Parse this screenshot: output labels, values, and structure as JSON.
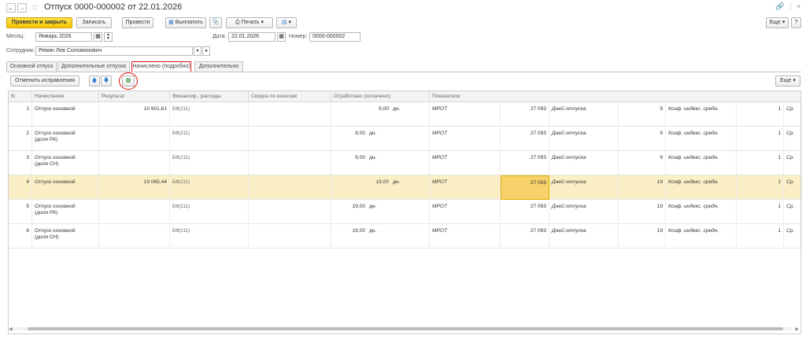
{
  "window": {
    "title": "Отпуск 0000-000002 от 22.01.2026",
    "more_label": "Еще",
    "help_label": "?"
  },
  "toolbar": {
    "post_close": "Провести и закрыть",
    "save": "Записать",
    "post": "Провести",
    "pay": "Выплатить",
    "print": "Печать"
  },
  "form": {
    "month_label": "Месяц:",
    "month_value": "Январь 2026",
    "date_label": "Дата:",
    "date_value": "22.01.2026",
    "number_label": "Номер:",
    "number_value": "0000-000002",
    "employee_label": "Сотрудник:",
    "employee_value": "Ревин Лев Соломонович"
  },
  "tabs": [
    {
      "label": "Основной отпуск"
    },
    {
      "label": "Дополнительные отпуска"
    },
    {
      "label": "Начислено (подробно)"
    },
    {
      "label": "Дополнительно"
    }
  ],
  "table_toolbar": {
    "cancel_corrections": "Отменить исправления",
    "more_label": "Еще"
  },
  "columns": {
    "n": "N",
    "accrual": "Начисления",
    "result": "Результат",
    "fin": "Финансир., расходы",
    "discount": "Скидка по взносам",
    "worked": "Отработано (оплачено)",
    "indicators": "Показатели"
  },
  "rows": [
    {
      "n": "1",
      "name1": "Отпуск основной",
      "name2": "",
      "result": "10 601,61",
      "fin": "БФ(211)",
      "worked": "9,00",
      "unit": "дн.",
      "mrot": "МРОТ",
      "mrot_val": "27 093",
      "ind1": "Дней отпуска",
      "ind1_val": "9",
      "ind2": "Коэф. индекс. средн.",
      "ind2_val": "1",
      "ind3": "Ср."
    },
    {
      "n": "2",
      "name1": "Отпуск основной",
      "name2": "(доля РК)",
      "result": "",
      "fin": "БФ(211)",
      "worked": "9,00",
      "unit": "дн.",
      "mrot": "МРОТ",
      "mrot_val": "27 093",
      "ind1": "Дней отпуска",
      "ind1_val": "9",
      "ind2": "Коэф. индекс. средн.",
      "ind2_val": "1",
      "ind3": "Ср."
    },
    {
      "n": "3",
      "name1": "Отпуск основной",
      "name2": "(доля СН)",
      "result": "",
      "fin": "БФ(211)",
      "worked": "9,00",
      "unit": "дн.",
      "mrot": "МРОТ",
      "mrot_val": "27 093",
      "ind1": "Дней отпуска",
      "ind1_val": "9",
      "ind2": "Коэф. индекс. средн.",
      "ind2_val": "1",
      "ind3": "Ср."
    },
    {
      "n": "4",
      "name1": "Отпуск основной",
      "name2": "",
      "result": "19 065,44",
      "fin": "БФ(211)",
      "worked": "19,00",
      "unit": "дн.",
      "mrot": "МРОТ",
      "mrot_val": "27 093",
      "ind1": "Дней отпуска",
      "ind1_val": "19",
      "ind2": "Коэф. индекс. средн.",
      "ind2_val": "1",
      "ind3": "Ср."
    },
    {
      "n": "5",
      "name1": "Отпуск основной",
      "name2": "(доля РК)",
      "result": "",
      "fin": "БФ(211)",
      "worked": "19,00",
      "unit": "дн.",
      "mrot": "МРОТ",
      "mrot_val": "27 093",
      "ind1": "Дней отпуска",
      "ind1_val": "19",
      "ind2": "Коэф. индекс. средн.",
      "ind2_val": "1",
      "ind3": "Ср."
    },
    {
      "n": "6",
      "name1": "Отпуск основной",
      "name2": "(доля СН)",
      "result": "",
      "fin": "БФ(211)",
      "worked": "19,00",
      "unit": "дн.",
      "mrot": "МРОТ",
      "mrot_val": "27 093",
      "ind1": "Дней отпуска",
      "ind1_val": "19",
      "ind2": "Коэф. индекс. средн.",
      "ind2_val": "1",
      "ind3": "Ср."
    }
  ],
  "colors": {
    "accent_yellow": "#f4c400",
    "selected_row": "#fbefc6",
    "highlight_red": "#e31212"
  }
}
